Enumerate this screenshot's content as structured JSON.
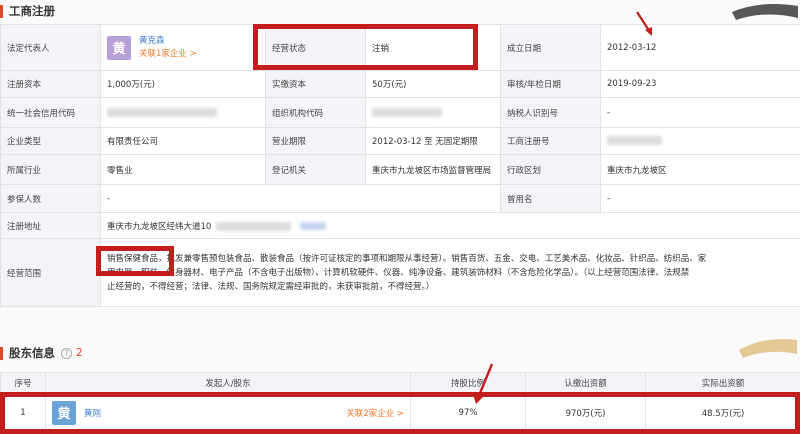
{
  "sections": {
    "registration": {
      "title": "工商注册"
    },
    "shareholders": {
      "title": "股东信息",
      "count": "2"
    }
  },
  "registration": {
    "legal_rep_label": "法定代表人",
    "legal_rep_avatar": "黄",
    "legal_rep_name": "黄克森",
    "legal_rep_link": "关联1家企业 >",
    "status_label": "经营状态",
    "status_value": "注销",
    "founded_label": "成立日期",
    "founded_value": "2012-03-12",
    "reg_capital_label": "注册资本",
    "reg_capital_value": "1,000万(元)",
    "paid_capital_label": "实缴资本",
    "paid_capital_value": "50万(元)",
    "approval_label": "审核/年检日期",
    "approval_value": "2019-09-23",
    "credit_code_label": "统一社会信用代码",
    "org_code_label": "组织机构代码",
    "taxpayer_id_label": "纳税人识别号",
    "taxpayer_id_value": "-",
    "company_type_label": "企业类型",
    "company_type_value": "有限责任公司",
    "term_label": "营业期限",
    "term_value": "2012-03-12 至 无固定期限",
    "reg_no_label": "工商注册号",
    "industry_label": "所属行业",
    "industry_value": "零售业",
    "authority_label": "登记机关",
    "authority_value": "重庆市九龙坡区市场监督管理局",
    "region_label": "行政区划",
    "region_value": "重庆市九龙坡区",
    "insured_label": "参保人数",
    "insured_value": "-",
    "former_name_label": "曾用名",
    "former_name_value": "-",
    "address_label": "注册地址",
    "address_value": "重庆市九龙坡区经纬大道10",
    "scope_label": "经营范围",
    "scope_highlight": "销售保健食",
    "scope_lines": [
      "品，批发兼零售预包装食品、散装食品（按许可证核定的事项和期限从事经营）。销售百货、五金、交电、工艺美术品、化妆品、针织品、纺织品、家",
      "用电器、服装、健身器材、电子产品（不含电子出版物）、计算机软硬件、仪器、纯净设备、建筑装饰材料（不含危险化学品）。（以上经营范围法律、法规禁",
      "止经营的，不得经营；法律、法规、国务院规定需经审批的，未获审批前，不得经营。）"
    ]
  },
  "shareholders": {
    "headers": [
      "序号",
      "发起人/股东",
      "持股比例",
      "认缴出资额",
      "实际出资额"
    ],
    "rows": [
      {
        "index": "1",
        "avatar": "黄",
        "name": "黄刚",
        "link": "关联2家企业 >",
        "ratio": "97%",
        "subscribed": "970万(元)",
        "paid": "48.5万(元)"
      }
    ]
  },
  "colors": {
    "highlight": "#c41d1d",
    "accent": "#e0492a",
    "link": "#3f7fd4",
    "link_alt": "#f07a2a"
  }
}
